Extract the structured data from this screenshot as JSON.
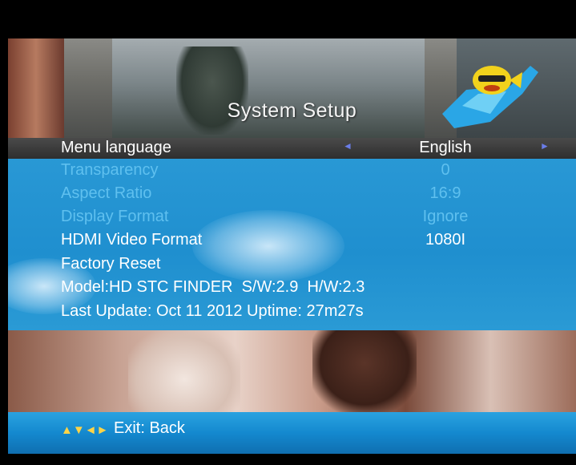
{
  "header": {
    "title": "System Setup"
  },
  "menu": {
    "items": [
      {
        "label": "Menu language",
        "value": "English"
      },
      {
        "label": "Transparency",
        "value": "0"
      },
      {
        "label": "Aspect Ratio",
        "value": "16:9"
      },
      {
        "label": "Display Format",
        "value": "Ignore"
      },
      {
        "label": "HDMI Video Format",
        "value": "1080I"
      },
      {
        "label": "Factory Reset",
        "value": ""
      }
    ],
    "selected_index": 0
  },
  "info": {
    "model_line": "Model:HD STC FINDER  S/W:2.9  H/W:2.3",
    "update_line": "Last Update: Oct 11 2012 Uptime: 27m27s"
  },
  "footer": {
    "nav_icons": "▲▼◄►",
    "exit_label": "Exit: Back"
  },
  "icons": {
    "left_arrow": "left-arrow-icon",
    "right_arrow": "right-arrow-icon",
    "mascot": "fish-guitar-mascot-icon"
  },
  "colors": {
    "menu_bg": "#1f8fcf",
    "selected_row": "#3a3a3a",
    "dim_text": "#5fc0ef",
    "footer_bg": "#1489cf"
  }
}
